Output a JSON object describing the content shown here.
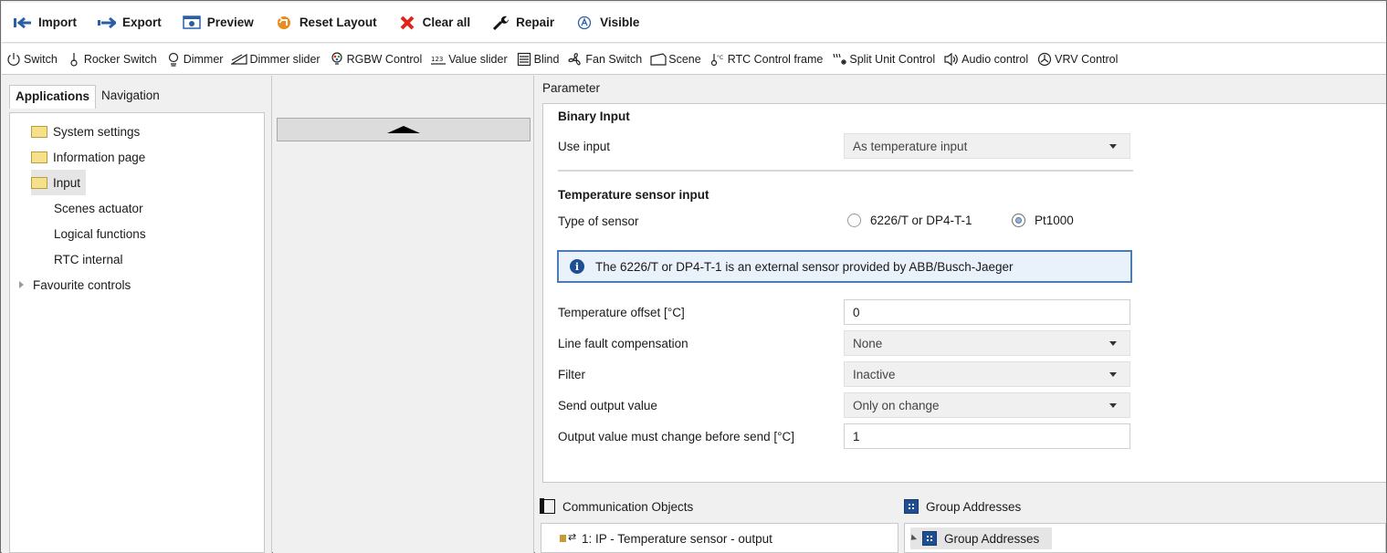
{
  "toolbar": {
    "import": "Import",
    "export": "Export",
    "preview": "Preview",
    "reset_layout": "Reset Layout",
    "clear_all": "Clear all",
    "repair": "Repair",
    "visible": "Visible"
  },
  "controls": {
    "switch": "Switch",
    "rocker_switch": "Rocker Switch",
    "dimmer": "Dimmer",
    "dimmer_slider": "Dimmer slider",
    "rgbw_control": "RGBW Control",
    "value_slider": "Value slider",
    "blind": "Blind",
    "fan_switch": "Fan Switch",
    "scene": "Scene",
    "rtc_control_frame": "RTC Control frame",
    "split_unit_control": "Split Unit Control",
    "audio_control": "Audio control",
    "vrv_control": "VRV Control"
  },
  "left": {
    "tabs": [
      "Applications",
      "Navigation"
    ],
    "tree": [
      "System settings",
      "Information page",
      "Input",
      "Scenes actuator",
      "Logical functions",
      "RTC internal",
      "Favourite controls"
    ]
  },
  "parameter": {
    "title": "Parameter",
    "binary_input_heading": "Binary Input",
    "use_input_label": "Use input",
    "use_input_value": "As temperature input",
    "temp_sensor_heading": "Temperature sensor input",
    "type_of_sensor_label": "Type of sensor",
    "sensor_option_1": "6226/T or DP4-T-1",
    "sensor_option_2": "Pt1000",
    "sensor_selected": "Pt1000",
    "info_text": "The 6226/T or DP4-T-1 is an external sensor provided by ABB/Busch-Jaeger",
    "temp_offset_label": "Temperature offset [°C]",
    "temp_offset_value": "0",
    "line_fault_label": "Line fault compensation",
    "line_fault_value": "None",
    "filter_label": "Filter",
    "filter_value": "Inactive",
    "send_output_label": "Send output value",
    "send_output_value": "Only on change",
    "output_change_label": "Output value must change before send [°C]",
    "output_change_value": "1"
  },
  "bottom": {
    "comm_objects_title": "Communication Objects",
    "comm_object_item": "1: IP - Temperature sensor - output",
    "group_addresses_title": "Group Addresses",
    "group_addresses_item": "Group Addresses"
  },
  "colors": {
    "accent": "#1f4f93",
    "info_bg": "#e9f1fa",
    "info_border": "#4e7ab6",
    "folder": "#f6e08a",
    "clear_red": "#e2231a",
    "reset_orange": "#e98b1e"
  }
}
